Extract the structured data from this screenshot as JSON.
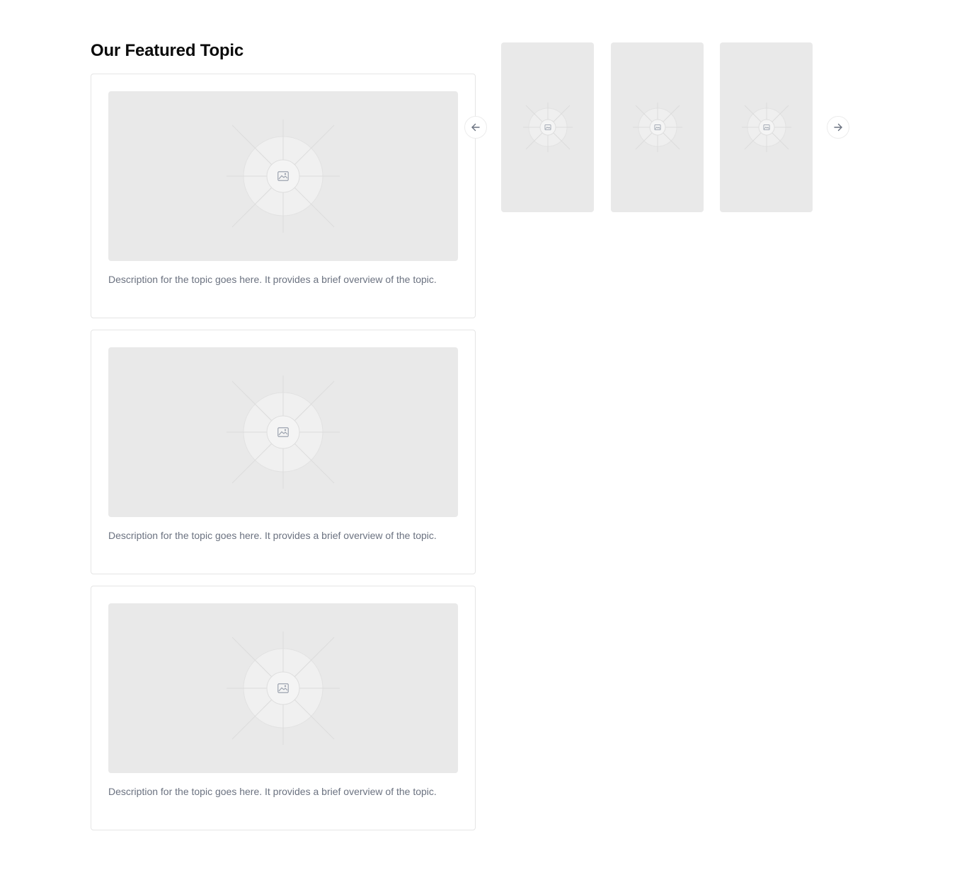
{
  "section": {
    "title": "Our Featured Topic"
  },
  "topics": [
    {
      "image_icon": "image-icon",
      "description": "Description for the topic goes here. It provides a brief overview of the topic."
    },
    {
      "image_icon": "image-icon",
      "description": "Description for the topic goes here. It provides a brief overview of the topic."
    },
    {
      "image_icon": "image-icon",
      "description": "Description for the topic goes here. It provides a brief overview of the topic."
    }
  ],
  "carousel": {
    "prev_icon": "arrow-left-icon",
    "next_icon": "arrow-right-icon",
    "slides": [
      {
        "image_icon": "image-icon"
      },
      {
        "image_icon": "image-icon"
      },
      {
        "image_icon": "image-icon"
      }
    ]
  },
  "colors": {
    "placeholder_bg": "#e9e9e9",
    "card_border": "#e5e5e5",
    "description_text": "#6b7280",
    "title_text": "#0b0b0b"
  }
}
